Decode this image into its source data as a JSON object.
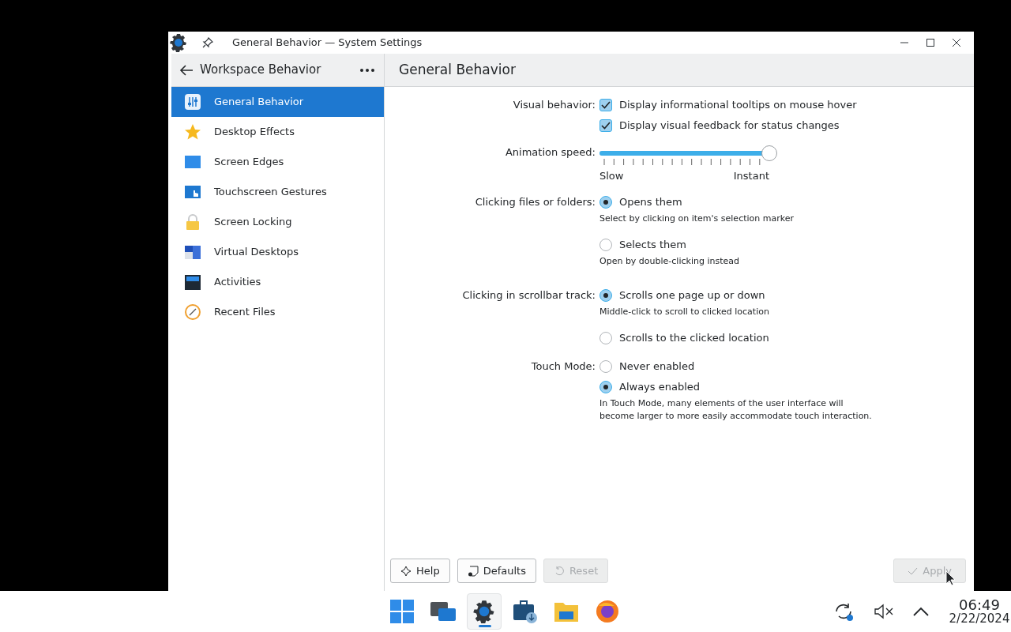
{
  "window": {
    "title": "General Behavior — System Settings"
  },
  "sidebar": {
    "header": "Workspace Behavior",
    "items": [
      {
        "label": "General Behavior",
        "selected": true
      },
      {
        "label": "Desktop Effects",
        "selected": false
      },
      {
        "label": "Screen Edges",
        "selected": false
      },
      {
        "label": "Touchscreen Gestures",
        "selected": false
      },
      {
        "label": "Screen Locking",
        "selected": false
      },
      {
        "label": "Virtual Desktops",
        "selected": false
      },
      {
        "label": "Activities",
        "selected": false
      },
      {
        "label": "Recent Files",
        "selected": false
      }
    ]
  },
  "page": {
    "title": "General Behavior",
    "rows": [
      {
        "kind": "checkboxes",
        "label": "Visual behavior:",
        "options": [
          {
            "label": "Display informational tooltips on mouse hover",
            "checked": true
          },
          {
            "label": "Display visual feedback for status changes",
            "checked": true
          }
        ]
      },
      {
        "kind": "slider",
        "label": "Animation speed:",
        "level": 1,
        "min_label": "Slow",
        "max_label": "Instant"
      },
      {
        "kind": "radios",
        "label": "Clicking files or folders:",
        "options": [
          {
            "label": "Opens them",
            "selected": true,
            "hint": "Select by clicking on item's selection marker"
          },
          {
            "label": "Selects them",
            "selected": false,
            "hint": "Open by double-clicking instead"
          }
        ]
      },
      {
        "kind": "radios",
        "label": "Clicking in scrollbar track:",
        "options": [
          {
            "label": "Scrolls one page up or down",
            "selected": true,
            "hint": "Middle-click to scroll to clicked location"
          },
          {
            "label": "Scrolls to the clicked location",
            "selected": false
          }
        ]
      },
      {
        "kind": "radios",
        "label": "Touch Mode:",
        "options": [
          {
            "label": "Never enabled",
            "selected": false
          },
          {
            "label": "Always enabled",
            "selected": true,
            "hint": "In Touch Mode, many elements of the user interface will become larger to more easily accommodate touch interaction."
          }
        ]
      }
    ],
    "buttons": [
      {
        "label": "Help",
        "disabled": false
      },
      {
        "label": "Defaults",
        "disabled": false
      },
      {
        "label": "Reset",
        "disabled": true
      }
    ],
    "apply_button": {
      "label": "Apply",
      "disabled": true
    }
  },
  "taskbar": {
    "apps": [
      {
        "selected": false
      },
      {
        "selected": false
      },
      {
        "selected": true
      },
      {
        "selected": false
      },
      {
        "selected": false
      },
      {
        "selected": false
      }
    ],
    "time": "06:49",
    "date": "2/22/2024"
  }
}
